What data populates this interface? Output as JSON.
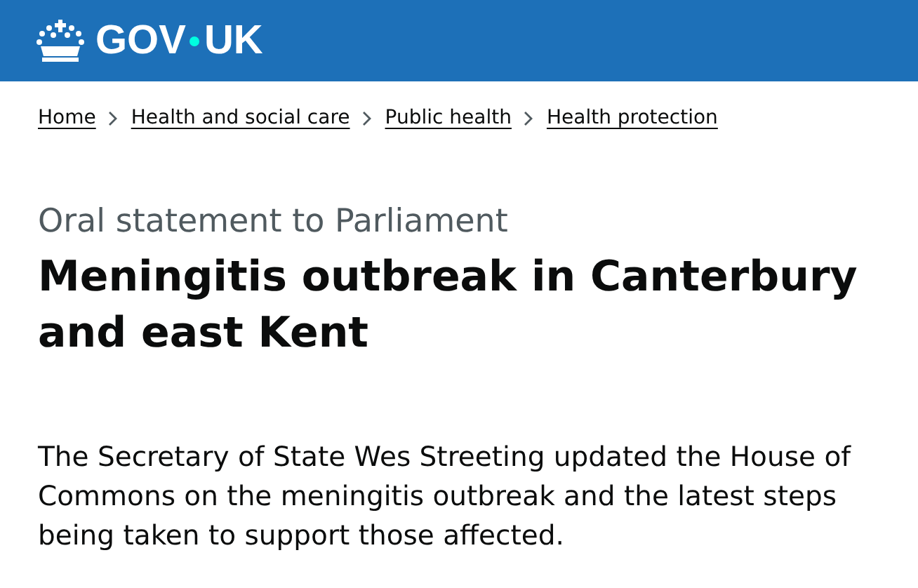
{
  "header": {
    "logo_left": "GOV",
    "logo_right": "UK"
  },
  "breadcrumbs": [
    {
      "label": "Home"
    },
    {
      "label": "Health and social care"
    },
    {
      "label": "Public health"
    },
    {
      "label": "Health protection"
    }
  ],
  "caption": "Oral statement to Parliament",
  "title": "Meningitis outbreak in Canterbury and east Kent",
  "lead": "The Secretary of State Wes Streeting updated the House of Commons on the meningitis outbreak and the latest steps being taken to support those affected."
}
